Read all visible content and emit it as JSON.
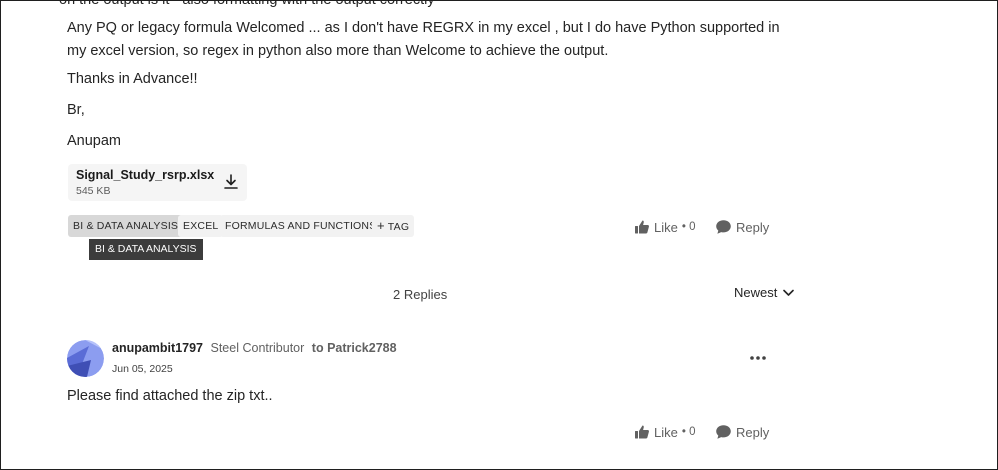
{
  "post": {
    "cut_line": "on the output is it - also formatting with the output  correctly",
    "paragraph1": "Any PQ or legacy formula Welcomed ... as I don't have REGRX in my excel , but I do have Python supported in my excel version, so regex in python also more than Welcome to achieve the output.",
    "paragraph2": "Thanks in Advance!!",
    "paragraph3": "Br,",
    "paragraph4": "Anupam",
    "attachment": {
      "name": "Signal_Study_rsrp.xlsx",
      "size": "545 KB",
      "icon": "download-icon"
    },
    "tags": [
      {
        "label": "BI & DATA ANALYSIS"
      },
      {
        "label": "EXCEL"
      },
      {
        "label": "FORMULAS AND FUNCTIONS"
      }
    ],
    "add_tag_label": "TAG",
    "tooltip": "BI & DATA ANALYSIS",
    "like_label": "Like",
    "like_count": "• 0",
    "reply_label": "Reply"
  },
  "replies_header": {
    "count_label": "2 Replies",
    "sort_label": "Newest"
  },
  "reply": {
    "author": "anupambit1797",
    "rank": "Steel Contributor",
    "to_label": "to Patrick2788",
    "date": "Jun 05, 2025",
    "body": "Please find attached the zip txt..",
    "like_label": "Like",
    "like_count": "• 0",
    "reply_label": "Reply"
  },
  "colors": {
    "avatar_dark": "#3f4fb5",
    "avatar_light": "#8c9df0",
    "icon_gray": "#616161",
    "tooltip_bg": "#3c3c3c"
  }
}
